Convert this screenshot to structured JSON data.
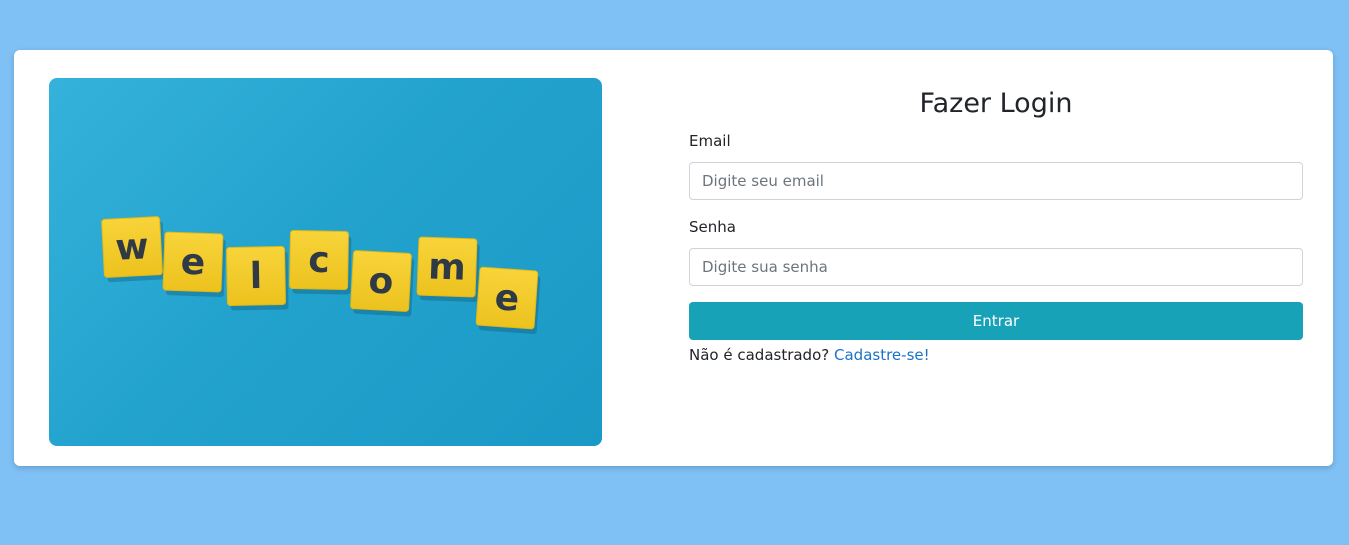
{
  "hero": {
    "letters": [
      "w",
      "e",
      "l",
      "c",
      "o",
      "m",
      "e"
    ]
  },
  "login": {
    "title": "Fazer Login",
    "email_label": "Email",
    "email_placeholder": "Digite seu email",
    "password_label": "Senha",
    "password_placeholder": "Digite sua senha",
    "submit_label": "Entrar",
    "signup_prompt": "Não é cadastrado?",
    "signup_link": "Cadastre-se!"
  },
  "colors": {
    "background": "#7fc0f5",
    "card": "#ffffff",
    "button": "#17a2b8",
    "link": "#1a73c9",
    "tile": "#f5cd2a",
    "tile_letter": "#2f3a46"
  }
}
